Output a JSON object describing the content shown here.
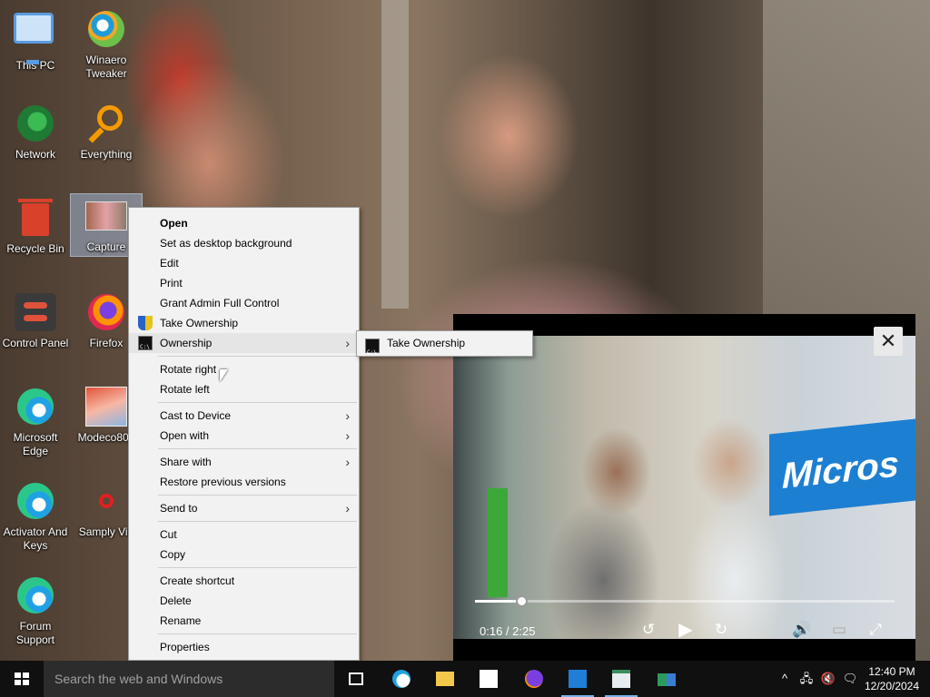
{
  "desktop": {
    "icons": [
      {
        "label": "This PC"
      },
      {
        "label": "Winaero Tweaker"
      },
      {
        "label": "Network"
      },
      {
        "label": "Everything"
      },
      {
        "label": "Recycle Bin"
      },
      {
        "label": "Capture"
      },
      {
        "label": "Control Panel"
      },
      {
        "label": "Firefox"
      },
      {
        "label": "Microsoft Edge"
      },
      {
        "label": "Modeco80_"
      },
      {
        "label": "Activator And Keys"
      },
      {
        "label": "Samply Vid"
      },
      {
        "label": "Forum Support"
      }
    ]
  },
  "context_menu": {
    "items": [
      {
        "label": "Open"
      },
      {
        "label": "Set as desktop background"
      },
      {
        "label": "Edit"
      },
      {
        "label": "Print"
      },
      {
        "label": "Grant Admin Full Control"
      },
      {
        "label": "Take Ownership"
      },
      {
        "label": "Ownership"
      },
      {
        "label": "Rotate right"
      },
      {
        "label": "Rotate left"
      },
      {
        "label": "Cast to Device"
      },
      {
        "label": "Open with"
      },
      {
        "label": "Share with"
      },
      {
        "label": "Restore previous versions"
      },
      {
        "label": "Send to"
      },
      {
        "label": "Cut"
      },
      {
        "label": "Copy"
      },
      {
        "label": "Create shortcut"
      },
      {
        "label": "Delete"
      },
      {
        "label": "Rename"
      },
      {
        "label": "Properties"
      }
    ],
    "submenu": {
      "label": "Take Ownership"
    }
  },
  "player": {
    "current_time": "0:16",
    "duration": "2:25",
    "time_text": "0:16 / 2:25",
    "progress_fraction": 0.11,
    "banner_text": "Micros",
    "close_glyph": "✕"
  },
  "taskbar": {
    "search_placeholder": "Search the web and Windows",
    "clock_time": "12:40 PM",
    "clock_date": "12/20/2024",
    "accent": "#7ab3e8"
  }
}
